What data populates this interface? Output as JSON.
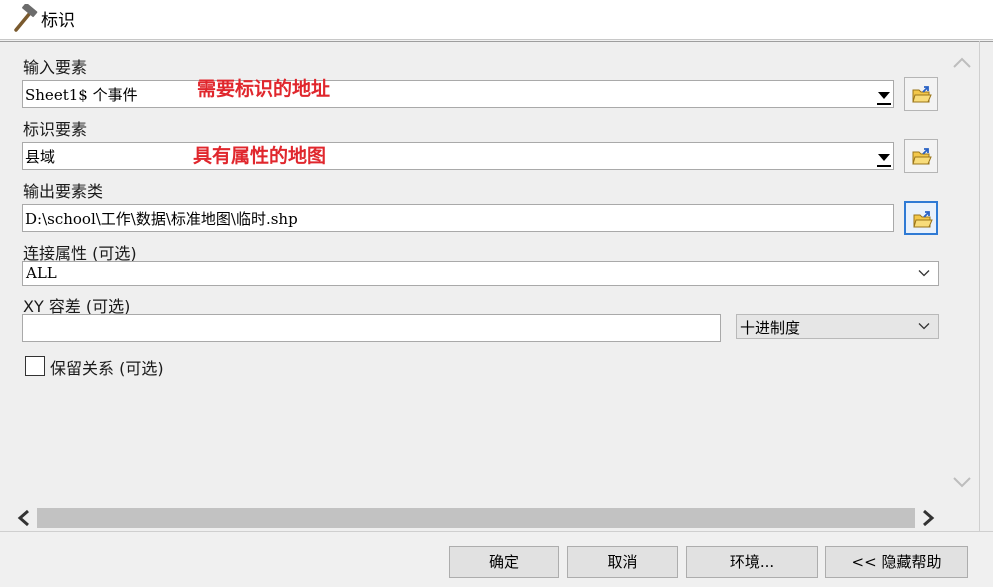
{
  "window": {
    "title": "标识",
    "icon": "hammer-icon"
  },
  "form": {
    "input_features": {
      "label": "输入要素",
      "value": "Sheet1$ 个事件",
      "annotation": "需要标识的地址"
    },
    "identity_features": {
      "label": "标识要素",
      "value": "县域",
      "annotation": "具有属性的地图"
    },
    "output_feature_class": {
      "label": "输出要素类",
      "value": "D:\\school\\工作\\数据\\标准地图\\临时.shp"
    },
    "join_attributes": {
      "label": "连接属性 (可选)",
      "value": "ALL"
    },
    "xy_tolerance": {
      "label": "XY 容差 (可选)",
      "value": "",
      "unit": "十进制度"
    },
    "keep_relationships": {
      "label": "保留关系 (可选)",
      "checked": false
    }
  },
  "buttons": {
    "ok": "确定",
    "cancel": "取消",
    "environments": "环境...",
    "hide_help": "<< 隐藏帮助"
  },
  "colors": {
    "annotation": "#e0272d",
    "focus_border": "#2f7ad4"
  }
}
